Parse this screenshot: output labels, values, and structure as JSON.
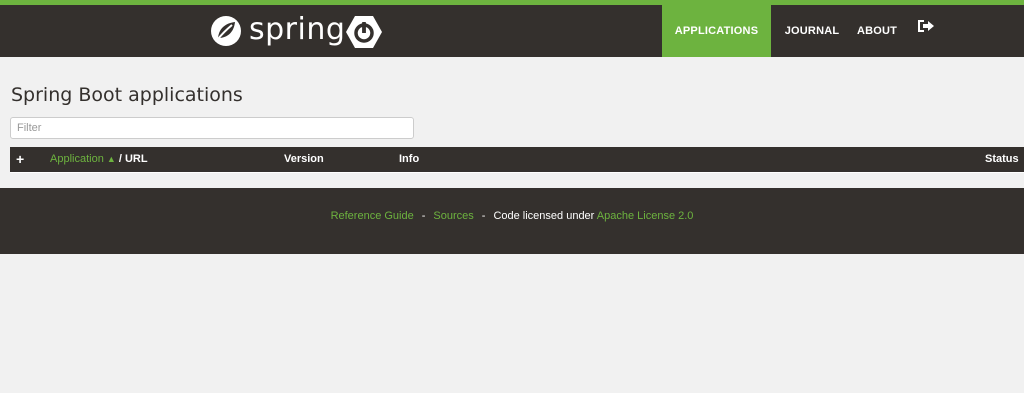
{
  "brand": {
    "logo_text": "spring"
  },
  "nav": {
    "items": [
      {
        "label": "APPLICATIONS",
        "active": true
      },
      {
        "label": "JOURNAL",
        "active": false
      },
      {
        "label": "ABOUT",
        "active": false
      }
    ],
    "logout_icon": "sign-out-icon"
  },
  "main": {
    "title": "Spring Boot applications",
    "filter_placeholder": "Filter",
    "table": {
      "add_icon": "+",
      "columns": {
        "application": "Application",
        "sort_arrow": "▲",
        "url": " / URL",
        "version": "Version",
        "info": "Info",
        "status": "Status"
      },
      "rows": []
    }
  },
  "footer": {
    "reference_guide": "Reference Guide",
    "sep1": "-",
    "sources": "Sources",
    "sep2": "-",
    "license_text": "Code licensed under ",
    "license_link": "Apache License 2.0"
  },
  "colors": {
    "brand_green": "#6db33f",
    "dark": "#34302d",
    "background": "#f1f1f1"
  }
}
